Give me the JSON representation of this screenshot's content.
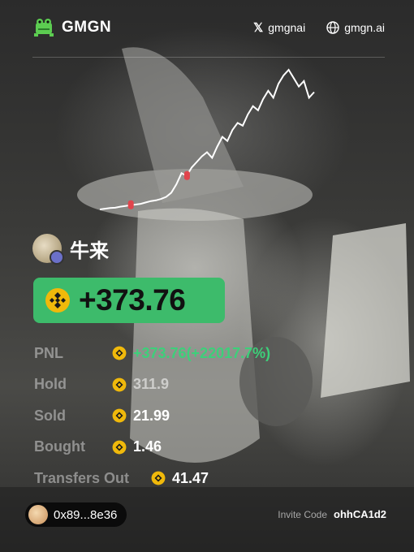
{
  "brand": {
    "name": "GMGN"
  },
  "social": {
    "x_handle": "gmgnai",
    "site": "gmgn.ai",
    "x_icon_glyph": "𝕏"
  },
  "user": {
    "name": "牛来"
  },
  "pnl": {
    "value": "+373.76"
  },
  "stats": {
    "pnl_label": "PNL",
    "pnl_value": "+373.76(+22017.7%)",
    "hold_label": "Hold",
    "hold_value": "311.9",
    "sold_label": "Sold",
    "sold_value": "21.99",
    "bought_label": "Bought",
    "bought_value": "1.46",
    "transfers_label": "Transfers Out",
    "transfers_value": "41.47"
  },
  "wallet": {
    "address": "0x89...8e36"
  },
  "invite": {
    "label": "Invite Code",
    "code": "ohhCA1d2"
  },
  "colors": {
    "accent_green": "#3dbb6b",
    "bnb_yellow": "#f0b90b"
  },
  "icons": [
    "gmgn-frog-logo",
    "x-icon",
    "globe-icon",
    "bnb-coin-icon",
    "avatar",
    "wallet-avatar"
  ],
  "chart_data": {
    "type": "line",
    "title": "",
    "xlabel": "",
    "ylabel": "",
    "series": [
      {
        "values": [
          0,
          0.5,
          1,
          1.2,
          2,
          2.5,
          3,
          3.5,
          4,
          5,
          6,
          6.5,
          7.5,
          9,
          12,
          18,
          26,
          24,
          30,
          34,
          38,
          41,
          37,
          45,
          52,
          49,
          57,
          62,
          60,
          68,
          74,
          71,
          79,
          85,
          80,
          90,
          96,
          100,
          94,
          88,
          92,
          80,
          84
        ]
      }
    ]
  }
}
